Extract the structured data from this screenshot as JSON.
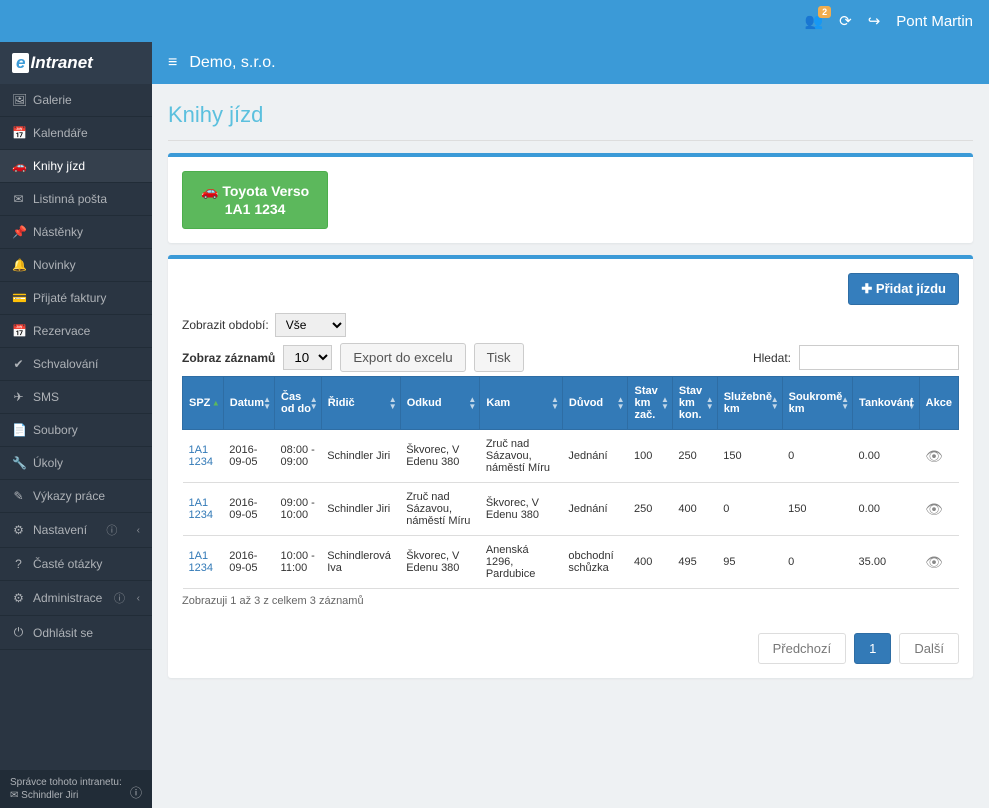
{
  "topbar": {
    "notification_count": "2",
    "user_name": "Pont Martin"
  },
  "logo": {
    "e": "e",
    "rest": "Intranet"
  },
  "subheader": {
    "company": "Demo, s.r.o."
  },
  "nav": [
    {
      "icon": "🖼",
      "label": "Galerie"
    },
    {
      "icon": "📅",
      "label": "Kalendáře"
    },
    {
      "icon": "🚗",
      "label": "Knihy jízd",
      "active": true
    },
    {
      "icon": "✉",
      "label": "Listinná pošta"
    },
    {
      "icon": "📌",
      "label": "Nástěnky"
    },
    {
      "icon": "🔔",
      "label": "Novinky"
    },
    {
      "icon": "💳",
      "label": "Přijaté faktury"
    },
    {
      "icon": "📅",
      "label": "Rezervace"
    },
    {
      "icon": "✔",
      "label": "Schvalování"
    },
    {
      "icon": "✈",
      "label": "SMS"
    },
    {
      "icon": "📄",
      "label": "Soubory"
    },
    {
      "icon": "🔧",
      "label": "Úkoly"
    },
    {
      "icon": "✎",
      "label": "Výkazy práce"
    },
    {
      "icon": "⚙",
      "label": "Nastavení",
      "info": true,
      "chev": true
    },
    {
      "icon": "?",
      "label": "Časté otázky"
    },
    {
      "icon": "⚙",
      "label": "Administrace",
      "info": true,
      "chev": true
    },
    {
      "icon": "⏻",
      "label": "Odhlásit se"
    }
  ],
  "footer": {
    "label": "Správce tohoto intranetu:",
    "admin": "✉ Schindler Jiri"
  },
  "page": {
    "title": "Knihy jízd",
    "car": {
      "name": "Toyota Verso",
      "plate": "1A1 1234"
    },
    "add_btn": "✚ Přidat jízdu",
    "period_label": "Zobrazit období:",
    "period_value": "Vše",
    "show_label": "Zobraz záznamů",
    "show_value": "10",
    "export_btn": "Export do excelu",
    "print_btn": "Tisk",
    "search_label": "Hledat:"
  },
  "columns": [
    "SPZ",
    "Datum",
    "Čas od do",
    "Řidič",
    "Odkud",
    "Kam",
    "Důvod",
    "Stav km zač.",
    "Stav km kon.",
    "Služebně km",
    "Soukromě km",
    "Tankování",
    "Akce"
  ],
  "rows": [
    {
      "spz": "1A1 1234",
      "date": "2016-09-05",
      "time": "08:00 - 09:00",
      "driver": "Schindler Jiri",
      "from": "Škvorec, V Edenu 380",
      "to": "Zruč nad Sázavou, náměstí Míru",
      "reason": "Jednání",
      "start": "100",
      "end": "250",
      "biz": "150",
      "priv": "0",
      "fuel": "0.00"
    },
    {
      "spz": "1A1 1234",
      "date": "2016-09-05",
      "time": "09:00 - 10:00",
      "driver": "Schindler Jiri",
      "from": "Zruč nad Sázavou, náměstí Míru",
      "to": "Škvorec, V Edenu 380",
      "reason": "Jednání",
      "start": "250",
      "end": "400",
      "biz": "0",
      "priv": "150",
      "fuel": "0.00"
    },
    {
      "spz": "1A1 1234",
      "date": "2016-09-05",
      "time": "10:00 - 11:00",
      "driver": "Schindlerová Iva",
      "from": "Škvorec, V Edenu 380",
      "to": "Anenská 1296, Pardubice",
      "reason": "obchodní schůzka",
      "start": "400",
      "end": "495",
      "biz": "95",
      "priv": "0",
      "fuel": "35.00"
    }
  ],
  "table_footer": "Zobrazuji 1 až 3 z celkem 3 záznamů",
  "pagination": {
    "prev": "Předchozí",
    "pages": [
      "1"
    ],
    "next": "Další"
  }
}
